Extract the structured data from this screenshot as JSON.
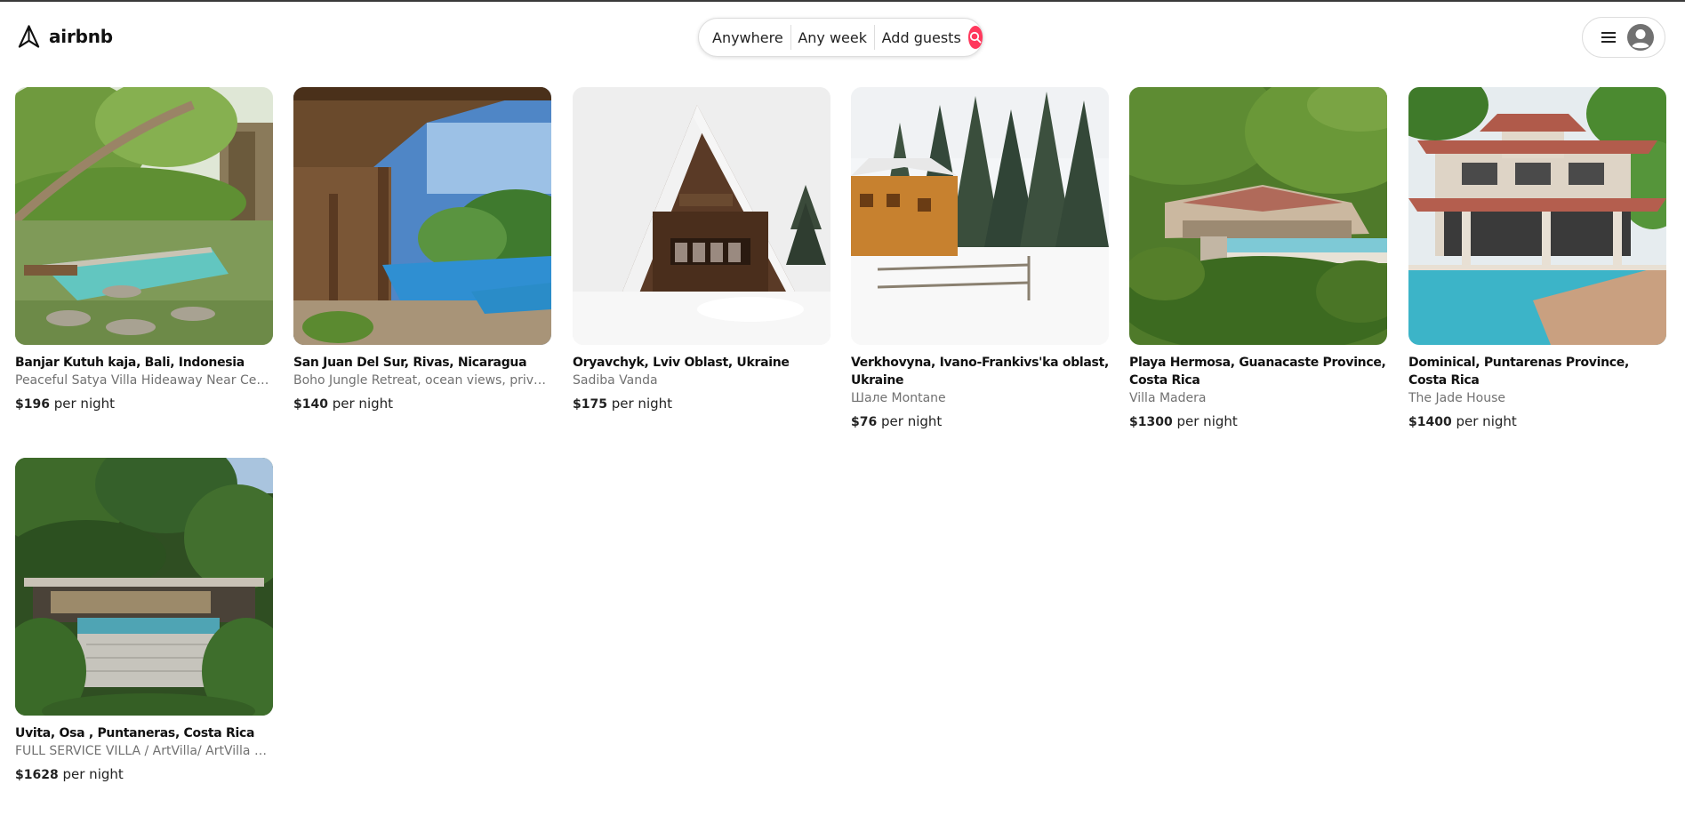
{
  "brand": {
    "name": "airbnb",
    "accent_color": "#ff385c"
  },
  "search": {
    "where": "Anywhere",
    "when": "Any week",
    "guests": "Add guests",
    "icon": "search-icon"
  },
  "user_menu": {
    "icons": [
      "hamburger-menu-icon",
      "avatar-icon"
    ]
  },
  "listings": [
    {
      "title": "Banjar Kutuh kaja, Bali, Indonesia",
      "subtitle": "Peaceful Satya Villa Hideaway Near Center of Ubud",
      "price": "$196",
      "price_suffix": "per night"
    },
    {
      "title": "San Juan Del Sur, Rivas, Nicaragua",
      "subtitle": "Boho Jungle Retreat, ocean views, private pool",
      "price": "$140",
      "price_suffix": "per night"
    },
    {
      "title": "Oryavchyk, Lviv Oblast, Ukraine",
      "subtitle": "Sadiba Vanda",
      "price": "$175",
      "price_suffix": "per night"
    },
    {
      "title": "Verkhovyna, Ivano-Frankivs'ka oblast, Ukraine",
      "subtitle": "Шале Montane",
      "price": "$76",
      "price_suffix": "per night"
    },
    {
      "title": "Playa Hermosa, Guanacaste Province, Costa Rica",
      "subtitle": "Villa Madera",
      "price": "$1300",
      "price_suffix": "per night"
    },
    {
      "title": "Dominical, Puntarenas Province, Costa Rica",
      "subtitle": "The Jade House",
      "price": "$1400",
      "price_suffix": "per night"
    },
    {
      "title": "Uvita, Osa , Puntaneras, Costa Rica",
      "subtitle": "FULL SERVICE VILLA / ArtVilla/ ArtVilla Costa Rica",
      "price": "$1628",
      "price_suffix": "per night"
    }
  ]
}
